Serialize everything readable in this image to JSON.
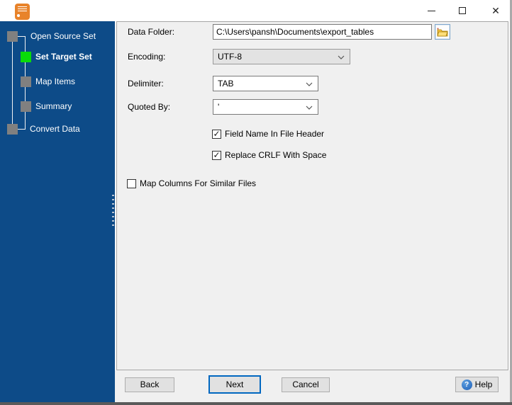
{
  "window": {
    "title": "",
    "controls": {
      "close_glyph": "✕"
    }
  },
  "sidebar": {
    "steps": [
      {
        "label": "Open Source Set",
        "state": "completed"
      },
      {
        "label": "Set Target Set",
        "state": "active"
      },
      {
        "label": "Map Items",
        "state": "upcoming"
      },
      {
        "label": "Summary",
        "state": "upcoming"
      },
      {
        "label": "Convert Data",
        "state": "upcoming"
      }
    ]
  },
  "form": {
    "data_folder": {
      "label": "Data Folder:",
      "value": "C:\\Users\\pansh\\Documents\\export_tables"
    },
    "encoding": {
      "label": "Encoding:",
      "value": "UTF-8"
    },
    "delimiter": {
      "label": "Delimiter:",
      "value": "TAB"
    },
    "quoted_by": {
      "label": "Quoted By:",
      "value": "'"
    },
    "options": [
      {
        "label": "Field Name In File Header",
        "checked": true
      },
      {
        "label": "Replace CRLF With Space",
        "checked": true
      },
      {
        "label": "Map Columns For Similar Files",
        "checked": false
      }
    ]
  },
  "buttons": {
    "back": "Back",
    "next": "Next",
    "cancel": "Cancel",
    "help": "Help"
  },
  "icons": {
    "check": "✓",
    "help_question": "?"
  },
  "colors": {
    "sidebar_blue": "#0D4B88",
    "active_step_green": "#09DC09",
    "step_gray": "#808080",
    "focus_blue": "#0067C0",
    "panel_bg": "#F0F0F0",
    "app_icon_orange": "#E8832A"
  }
}
